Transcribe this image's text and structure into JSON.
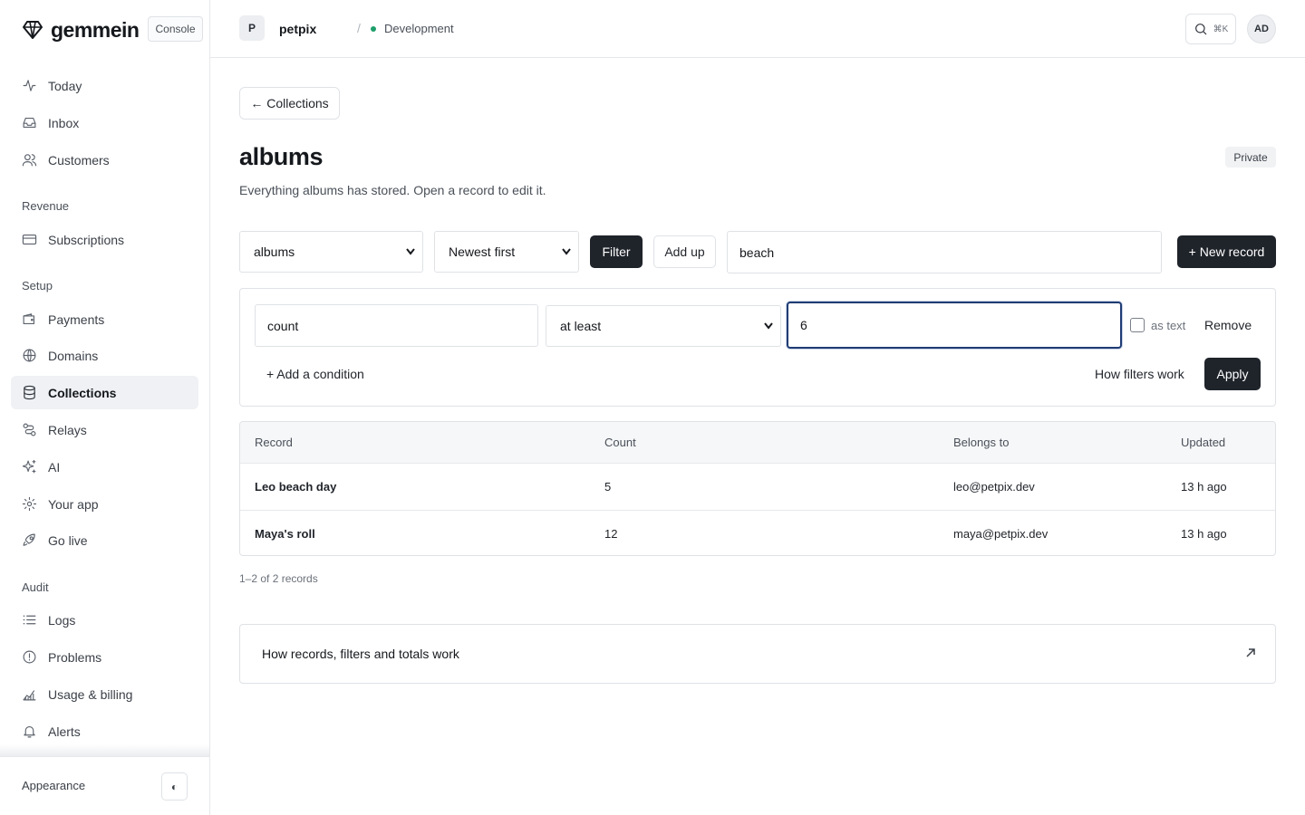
{
  "brand": {
    "name": "gemmein",
    "console_label": "Console"
  },
  "sidebar": {
    "items_primary": [
      {
        "label": "Today",
        "icon": "activity-icon"
      },
      {
        "label": "Inbox",
        "icon": "inbox-icon"
      },
      {
        "label": "Customers",
        "icon": "users-icon"
      }
    ],
    "sections": {
      "revenue": "Revenue",
      "setup": "Setup",
      "audit": "Audit"
    },
    "items_revenue": [
      {
        "label": "Subscriptions",
        "icon": "credit-card-icon"
      }
    ],
    "items_setup": [
      {
        "label": "Payments",
        "icon": "wallet-icon"
      },
      {
        "label": "Domains",
        "icon": "globe-icon"
      },
      {
        "label": "Collections",
        "icon": "database-icon",
        "active": true
      },
      {
        "label": "Relays",
        "icon": "route-icon"
      },
      {
        "label": "AI",
        "icon": "sparkles-icon"
      },
      {
        "label": "Your app",
        "icon": "gear-icon"
      },
      {
        "label": "Go live",
        "icon": "rocket-icon"
      }
    ],
    "items_audit": [
      {
        "label": "Logs",
        "icon": "list-icon"
      },
      {
        "label": "Problems",
        "icon": "alert-circle-icon"
      },
      {
        "label": "Usage & billing",
        "icon": "chart-icon"
      },
      {
        "label": "Alerts",
        "icon": "bell-icon"
      }
    ],
    "appearance_label": "Appearance",
    "theme_toggle_glyph": "◐"
  },
  "topbar": {
    "project_initial": "P",
    "project_name": "petpix",
    "separator": "/",
    "environment": "Development",
    "search_shortcut": "⌘K",
    "user_initials": "AD"
  },
  "page": {
    "back_label": "← Collections",
    "title": "albums",
    "visibility": "Private",
    "description": "Everything albums has stored. Open a record to edit it."
  },
  "toolbar": {
    "collection_select": "albums",
    "sort_select": "Newest first",
    "filter_label": "Filter",
    "add_up_label": "Add up",
    "search_value": "beach",
    "new_record_label": "+ New record"
  },
  "filter": {
    "field": "count",
    "operator": "at least",
    "value": "6",
    "as_text_label": "as text",
    "as_text_checked": false,
    "remove_label": "Remove",
    "add_condition_label": "+ Add a condition",
    "how_label": "How filters work",
    "apply_label": "Apply"
  },
  "table": {
    "columns": [
      "Record",
      "Count",
      "Belongs to",
      "Updated"
    ],
    "rows": [
      {
        "record": "Leo beach day",
        "count": "5",
        "belongs_to": "leo@petpix.dev",
        "updated": "13 h ago"
      },
      {
        "record": "Maya's roll",
        "count": "12",
        "belongs_to": "maya@petpix.dev",
        "updated": "13 h ago"
      }
    ],
    "pagination": "1–2 of 2 records"
  },
  "help": {
    "title": "How records, filters and totals work"
  },
  "colors": {
    "accent_dark": "#1f232a",
    "active_bg": "#eff1f4",
    "env_dot": "#1e9e6a",
    "focus_border": "#1f3c74"
  }
}
